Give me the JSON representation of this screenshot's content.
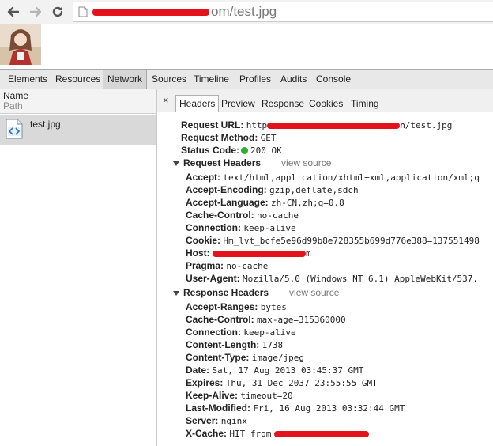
{
  "browser": {
    "url_path": "om/test.jpg"
  },
  "devtools": {
    "tabs": [
      "Elements",
      "Resources",
      "Network",
      "Sources",
      "Timeline",
      "Profiles",
      "Audits",
      "Console"
    ],
    "active_tab": "Network"
  },
  "network": {
    "columns": {
      "name": "Name",
      "path": "Path"
    },
    "file": {
      "name": "test.jpg"
    }
  },
  "detail": {
    "close": "×",
    "subtabs": [
      "Headers",
      "Preview",
      "Response",
      "Cookies",
      "Timing"
    ],
    "active_subtab": "Headers",
    "general": {
      "request_url_label": "Request URL:",
      "request_url_prefix": "http",
      "request_url_suffix": "n/test.jpg",
      "method_label": "Request Method:",
      "method": "GET",
      "status_label": "Status Code:",
      "status": "200 OK",
      "status_color": "#29b032"
    },
    "request_headers": {
      "title": "Request Headers",
      "view_source": "view source",
      "items": [
        {
          "k": "Accept:",
          "v": "text/html,application/xhtml+xml,application/xml;q"
        },
        {
          "k": "Accept-Encoding:",
          "v": "gzip,deflate,sdch"
        },
        {
          "k": "Accept-Language:",
          "v": "zh-CN,zh;q=0.8"
        },
        {
          "k": "Cache-Control:",
          "v": "no-cache"
        },
        {
          "k": "Connection:",
          "v": "keep-alive"
        },
        {
          "k": "Cookie:",
          "v": "Hm_lvt_bcfe5e96d99b8e728355b699d776e388=137551498"
        },
        {
          "k": "Host:",
          "v": "m"
        },
        {
          "k": "Pragma:",
          "v": "no-cache"
        },
        {
          "k": "User-Agent:",
          "v": "Mozilla/5.0 (Windows NT 6.1) AppleWebKit/537."
        }
      ]
    },
    "response_headers": {
      "title": "Response Headers",
      "view_source": "view source",
      "items": [
        {
          "k": "Accept-Ranges:",
          "v": "bytes"
        },
        {
          "k": "Cache-Control:",
          "v": "max-age=315360000"
        },
        {
          "k": "Connection:",
          "v": "keep-alive"
        },
        {
          "k": "Content-Length:",
          "v": "1738"
        },
        {
          "k": "Content-Type:",
          "v": "image/jpeg"
        },
        {
          "k": "Date:",
          "v": "Sat, 17 Aug 2013 03:45:37 GMT"
        },
        {
          "k": "Expires:",
          "v": "Thu, 31 Dec 2037 23:55:55 GMT"
        },
        {
          "k": "Keep-Alive:",
          "v": "timeout=20"
        },
        {
          "k": "Last-Modified:",
          "v": "Fri, 16 Aug 2013 03:32:44 GMT"
        },
        {
          "k": "Server:",
          "v": "nginx"
        },
        {
          "k": "X-Cache:",
          "v": "HIT from"
        }
      ]
    }
  }
}
